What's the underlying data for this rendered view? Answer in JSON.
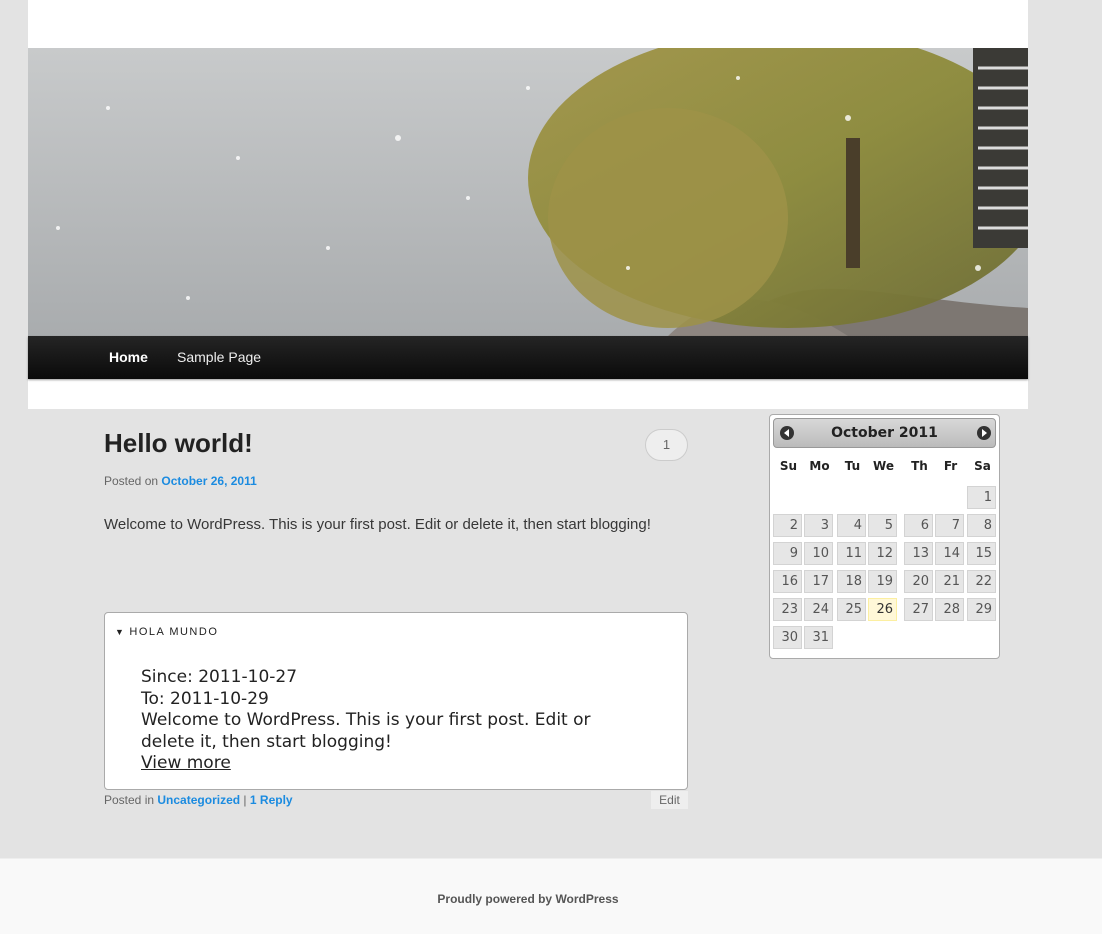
{
  "nav": {
    "items": [
      {
        "label": "Home",
        "current": true
      },
      {
        "label": "Sample Page",
        "current": false
      }
    ]
  },
  "post": {
    "title": "Hello world!",
    "comments_count": "1",
    "posted_on_label": "Posted on",
    "date": "October 26, 2011",
    "body": "Welcome to WordPress. This is your first post. Edit or delete it, then start blogging!"
  },
  "widget": {
    "title": "HOLA MUNDO",
    "since": "Since: 2011-10-27",
    "to": "To: 2011-10-29",
    "text": "Welcome to WordPress. This is your first post. Edit or delete it, then start blogging!",
    "view_more": "View more"
  },
  "post_footer": {
    "posted_in_label": "Posted in",
    "category": "Uncategorized",
    "separator": "|",
    "replies": "1 Reply",
    "edit": "Edit"
  },
  "calendar": {
    "title": "October 2011",
    "days_of_week": [
      "Su",
      "Mo",
      "Tu",
      "We",
      "Th",
      "Fr",
      "Sa"
    ],
    "first_weekday": 6,
    "days_in_month": 31,
    "today": 26
  },
  "footer": {
    "credit": "Proudly powered by WordPress"
  },
  "colors": {
    "link": "#1b8be0",
    "nav_bg": "#111111",
    "page_bg": "#e3e3e3"
  }
}
